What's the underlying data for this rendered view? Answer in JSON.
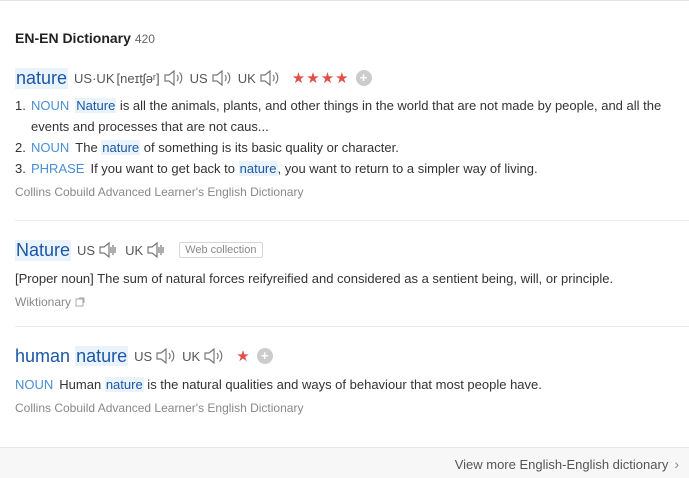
{
  "header": {
    "title": "EN-EN Dictionary",
    "count": "420"
  },
  "entry1": {
    "word": "nature",
    "pron_us_uk_label": "US·UK",
    "ipa": "[neɪtʃəʳ]",
    "us_label": "US",
    "uk_label": "UK",
    "stars": "★★★★",
    "plus": "+",
    "defs": [
      {
        "num": "1.",
        "pos": "NOUN",
        "pre": "",
        "hl": "Nature",
        "post": " is all the animals, plants, and other things in the world that are not made by people, and all the events and processes that are not caus..."
      },
      {
        "num": "2.",
        "pos": "NOUN",
        "pre": "The ",
        "hl": "nature",
        "post": " of something is its basic quality or character."
      },
      {
        "num": "3.",
        "pos": "PHRASE",
        "pre": "If you want to get back to ",
        "hl": "nature",
        "post": ", you want to return to a simpler way of living."
      }
    ],
    "source": "Collins Cobuild Advanced Learner's English Dictionary"
  },
  "entry2": {
    "word": "Nature",
    "us_label": "US",
    "uk_label": "UK",
    "tag": "Web collection",
    "def": "[Proper noun] The sum of natural forces reifyreified and considered as a sentient being, will, or principle.",
    "source": "Wiktionary"
  },
  "entry3": {
    "word_pre": "human",
    "word_hl": "nature",
    "us_label": "US",
    "uk_label": "UK",
    "stars": "★",
    "plus": "+",
    "pos": "NOUN",
    "pre": "Human ",
    "hl": "nature",
    "post": " is the natural qualities and ways of behaviour that most people have.",
    "source": "Collins Cobuild Advanced Learner's English Dictionary"
  },
  "footer": {
    "more": "View more English-English dictionary"
  },
  "colors": {
    "link": "#1a57a8",
    "pos": "#4a8fd4",
    "star": "#e0504a",
    "highlight_bg": "#eaf3fc"
  }
}
